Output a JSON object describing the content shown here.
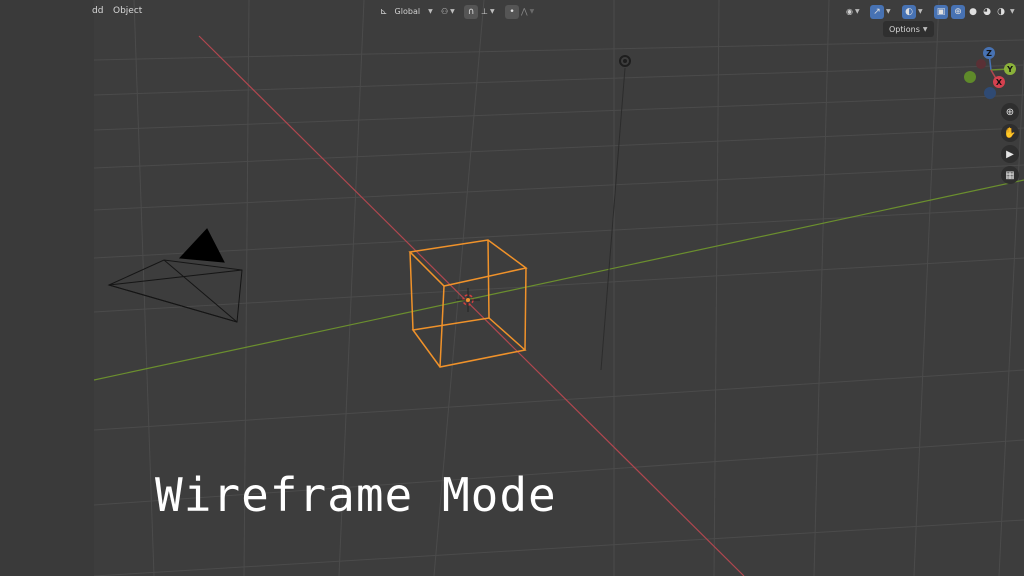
{
  "header": {
    "menu_add_partial": "dd",
    "menu_object": "Object",
    "transform_orientation": "Global",
    "options_label": "Options"
  },
  "gizmo": {
    "z_label": "Z",
    "y_label": "Y",
    "x_label": "X"
  },
  "overlay_caption": "Wireframe Mode",
  "colors": {
    "viewport_bg": "#3d3d3d",
    "grid_line": "#4a4a4a",
    "x_axis": "#b0474f",
    "y_axis": "#6b8f2e",
    "selected_object": "#f0922a",
    "accent": "#4772b3"
  }
}
